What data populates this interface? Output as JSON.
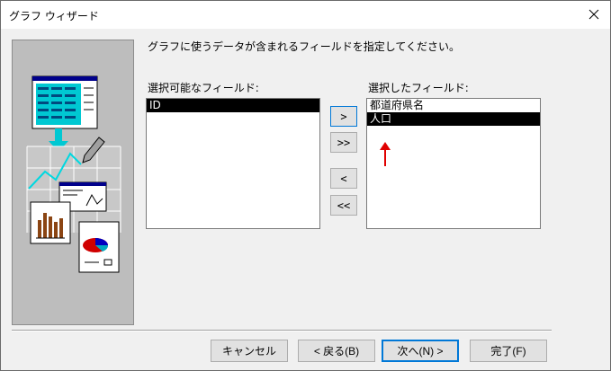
{
  "window": {
    "title": "グラフ ウィザード"
  },
  "instruction": "グラフに使うデータが含まれるフィールドを指定してください。",
  "available": {
    "label": "選択可能なフィールド:",
    "items": [
      {
        "label": "ID",
        "selected": true
      }
    ]
  },
  "selected": {
    "label": "選択したフィールド:",
    "items": [
      {
        "label": "都道府県名",
        "selected": false
      },
      {
        "label": "人口",
        "selected": true
      }
    ]
  },
  "move_buttons": {
    "add": ">",
    "add_all": ">>",
    "remove": "<",
    "remove_all": "<<"
  },
  "footer": {
    "cancel": "キャンセル",
    "back": "< 戻る(B)",
    "next": "次へ(N) >",
    "finish": "完了(F)"
  },
  "colors": {
    "selection": "#000000",
    "focus_border": "#0078d7",
    "annotation_arrow": "#e00000"
  }
}
